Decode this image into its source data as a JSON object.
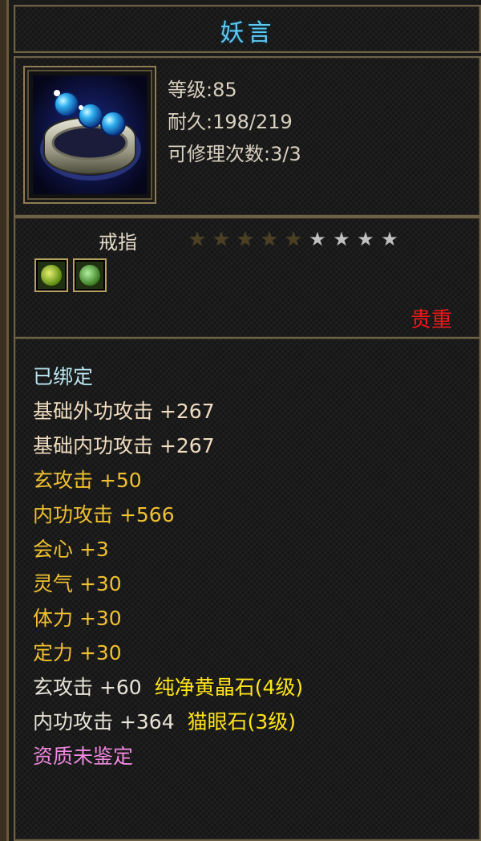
{
  "item": {
    "name": "妖言",
    "level": "等级:85",
    "durability": "耐久:198/219",
    "repairs": "可修理次数:3/3",
    "type": "戒指",
    "rarity": "贵重",
    "stars": {
      "filled": 5,
      "total": 9
    },
    "icon": "ring-icon"
  },
  "gems": [
    {
      "name": "yellow-gem-icon"
    },
    {
      "name": "green-gem-icon"
    }
  ],
  "attributes": [
    {
      "text": "已绑定",
      "color": "bound"
    },
    {
      "text": "基础外功攻击  +267",
      "color": "base"
    },
    {
      "text": "基础内功攻击  +267",
      "color": "base"
    },
    {
      "text": "玄攻击  +50",
      "color": "gold"
    },
    {
      "text": "内功攻击  +566",
      "color": "gold"
    },
    {
      "text": "会心  +3",
      "color": "gold"
    },
    {
      "text": "灵气  +30",
      "color": "gold"
    },
    {
      "text": "体力  +30",
      "color": "gold"
    },
    {
      "text": "定力  +30",
      "color": "gold"
    },
    {
      "text": "玄攻击  +60",
      "gem": "纯净黄晶石(4级)",
      "color": "white"
    },
    {
      "text": "内功攻击  +364",
      "gem": "猫眼石(3级)",
      "color": "white"
    },
    {
      "text": "资质未鉴定",
      "color": "pink"
    }
  ],
  "colors": {
    "title": "#5fc8f0",
    "rarity": "#f01818",
    "gold": "#f0c030",
    "pink": "#f088e0",
    "gem_name": "#ffe41a"
  }
}
